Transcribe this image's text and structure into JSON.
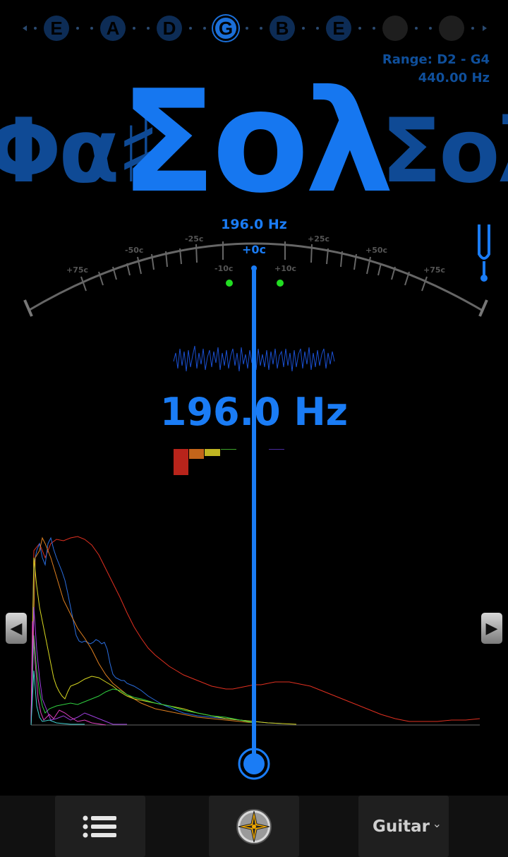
{
  "strings": {
    "items": [
      {
        "label": "E",
        "state": "normal"
      },
      {
        "label": "A",
        "state": "normal"
      },
      {
        "label": "D",
        "state": "normal"
      },
      {
        "label": "G",
        "state": "active"
      },
      {
        "label": "B",
        "state": "normal"
      },
      {
        "label": "E",
        "state": "normal"
      },
      {
        "label": "",
        "state": "empty"
      },
      {
        "label": "",
        "state": "empty"
      }
    ]
  },
  "range": {
    "text": "Range: D2 - G4",
    "reference": "440.00 Hz"
  },
  "notes": {
    "previous": "Φα♯",
    "current": "Σολ",
    "next": "Σολ"
  },
  "meter": {
    "frequency_label": "196.0 Hz",
    "cents_label": "+0c",
    "scale_labels": [
      "+75c",
      "-50c",
      "-25c",
      "-10c",
      "+10c",
      "+25c",
      "+50c",
      "+75c"
    ],
    "fork_icon": "tuning-fork-icon"
  },
  "detected": {
    "frequency": "196.0 Hz"
  },
  "colors": {
    "accent": "#1a7cf5",
    "dim": "#0f4a95",
    "green": "#22dd22"
  },
  "nav": {
    "prev_icon": "◀",
    "next_icon": "▶"
  },
  "toolbar": {
    "menu_icon": "menu-list-icon",
    "compass_icon": "compass-icon",
    "instrument": "Guitar",
    "instrument_chevron": "⌄"
  }
}
